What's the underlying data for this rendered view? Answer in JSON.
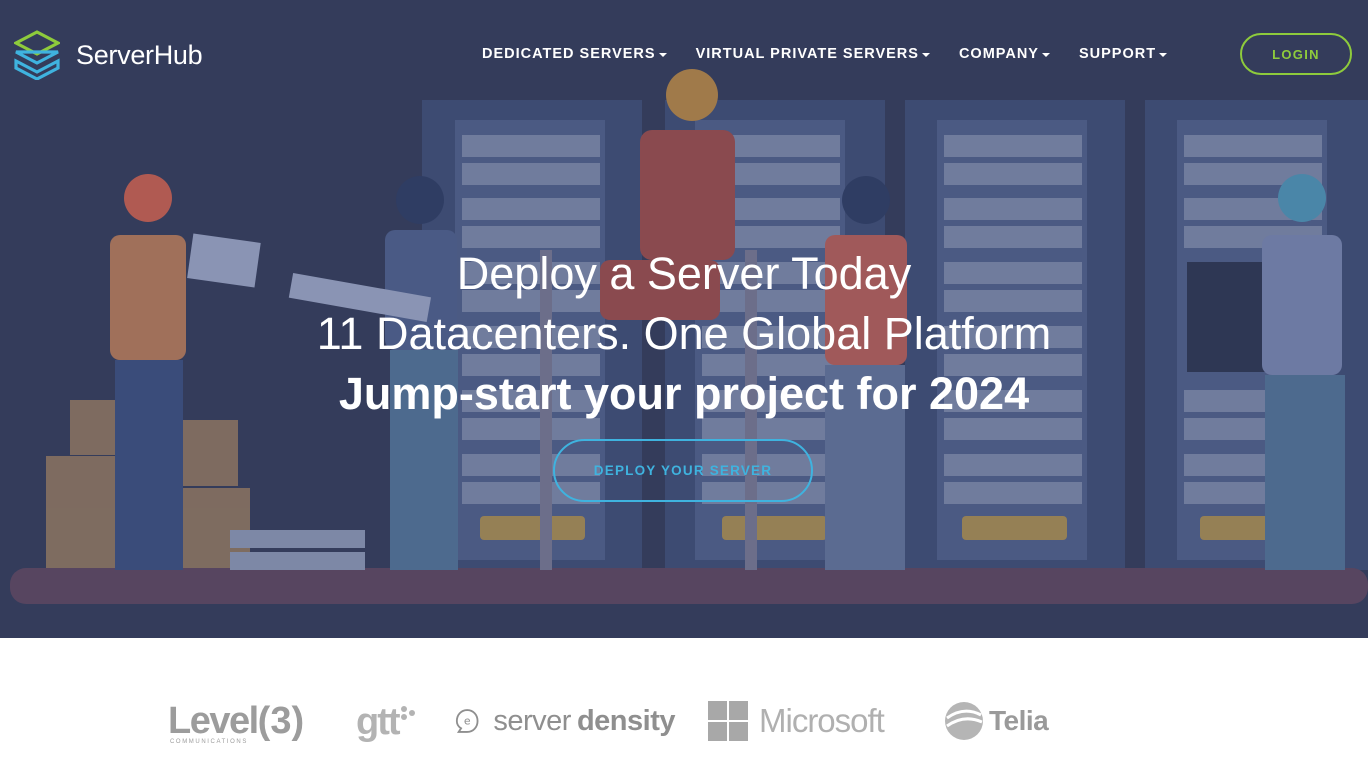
{
  "brand": {
    "name": "ServerHub",
    "icon": "layered-cube-icon",
    "accent": "#8ecb3c"
  },
  "nav": {
    "items": [
      {
        "label": "DEDICATED SERVERS"
      },
      {
        "label": "VIRTUAL PRIVATE SERVERS"
      },
      {
        "label": "COMPANY"
      },
      {
        "label": "SUPPORT"
      }
    ],
    "login_label": "LOGIN"
  },
  "hero": {
    "line1": "Deploy a Server Today",
    "line2": "11 Datacenters. One Global Platform",
    "line3": "Jump-start your project for 2024",
    "cta_label": "DEPLOY YOUR SERVER",
    "background": "#343c5b",
    "cta_color": "#3fb3df"
  },
  "partners": {
    "level3": {
      "name": "Level",
      "mark": "(3)",
      "tagline": "COMMUNICATIONS"
    },
    "gtt": {
      "name": "gtt"
    },
    "serverdensity": {
      "name_light": "server",
      "name_bold": "density"
    },
    "microsoft": {
      "name": "Microsoft"
    },
    "telia": {
      "name": "Telia"
    }
  }
}
